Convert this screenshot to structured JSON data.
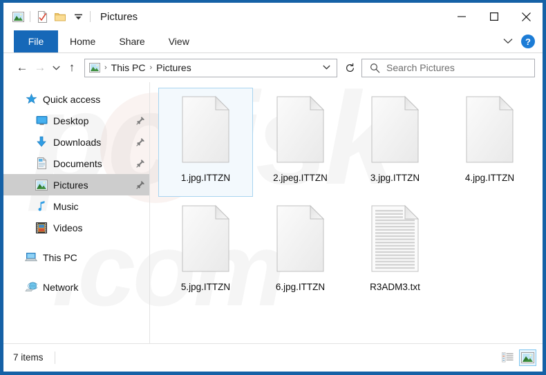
{
  "window": {
    "title": "Pictures",
    "accent_color": "#1561a6",
    "file_tab_color": "#1668b8",
    "quick_access_toolbar": [
      {
        "name": "pictures-folder-icon",
        "label": "Pictures"
      },
      {
        "name": "properties-icon",
        "label": "Properties"
      },
      {
        "name": "new-folder-icon",
        "label": "New folder"
      },
      {
        "name": "customize-qat-caret",
        "label": "Customize Quick Access Toolbar"
      }
    ],
    "controls": {
      "minimize": "—",
      "maximize": "□",
      "close": "✕"
    }
  },
  "ribbon": {
    "tabs": [
      {
        "label": "File",
        "active": true
      },
      {
        "label": "Home",
        "active": false
      },
      {
        "label": "Share",
        "active": false
      },
      {
        "label": "View",
        "active": false
      }
    ],
    "expand_label": "⌵",
    "help_label": "?"
  },
  "address": {
    "back": "←",
    "forward": "→",
    "recent": "⌵",
    "up": "↑",
    "breadcrumbs": [
      "This PC",
      "Pictures"
    ],
    "separator": "›",
    "caret": "⌵",
    "refresh": "↻"
  },
  "search": {
    "placeholder": "Search Pictures",
    "icon": "search-icon"
  },
  "sidebar": {
    "items": [
      {
        "label": "Quick access",
        "icon": "star-icon",
        "level": 0,
        "pinned": false,
        "selected": false
      },
      {
        "label": "Desktop",
        "icon": "desktop-icon",
        "level": 1,
        "pinned": true,
        "selected": false
      },
      {
        "label": "Downloads",
        "icon": "downloads-icon",
        "level": 1,
        "pinned": true,
        "selected": false
      },
      {
        "label": "Documents",
        "icon": "documents-icon",
        "level": 1,
        "pinned": true,
        "selected": false
      },
      {
        "label": "Pictures",
        "icon": "pictures-icon",
        "level": 1,
        "pinned": true,
        "selected": true
      },
      {
        "label": "Music",
        "icon": "music-icon",
        "level": 1,
        "pinned": false,
        "selected": false
      },
      {
        "label": "Videos",
        "icon": "videos-icon",
        "level": 1,
        "pinned": false,
        "selected": false
      },
      {
        "label": "This PC",
        "icon": "this-pc-icon",
        "level": 0,
        "pinned": false,
        "selected": false
      },
      {
        "label": "Network",
        "icon": "network-icon",
        "level": 0,
        "pinned": false,
        "selected": false
      }
    ]
  },
  "files": [
    {
      "label": "1.jpg.ITTZN",
      "type": "blank",
      "selected": true
    },
    {
      "label": "2.jpeg.ITTZN",
      "type": "blank",
      "selected": false
    },
    {
      "label": "3.jpg.ITTZN",
      "type": "blank",
      "selected": false
    },
    {
      "label": "4.jpg.ITTZN",
      "type": "blank",
      "selected": false
    },
    {
      "label": "5.jpg.ITTZN",
      "type": "blank",
      "selected": false
    },
    {
      "label": "6.jpg.ITTZN",
      "type": "blank",
      "selected": false
    },
    {
      "label": "R3ADM3.txt",
      "type": "text",
      "selected": false
    }
  ],
  "status": {
    "item_count": "7 items",
    "views": [
      {
        "name": "details-view-button",
        "active": false
      },
      {
        "name": "large-icons-view-button",
        "active": true
      }
    ]
  },
  "watermark": {
    "line1": "pcrisk",
    "line2": ".com"
  }
}
